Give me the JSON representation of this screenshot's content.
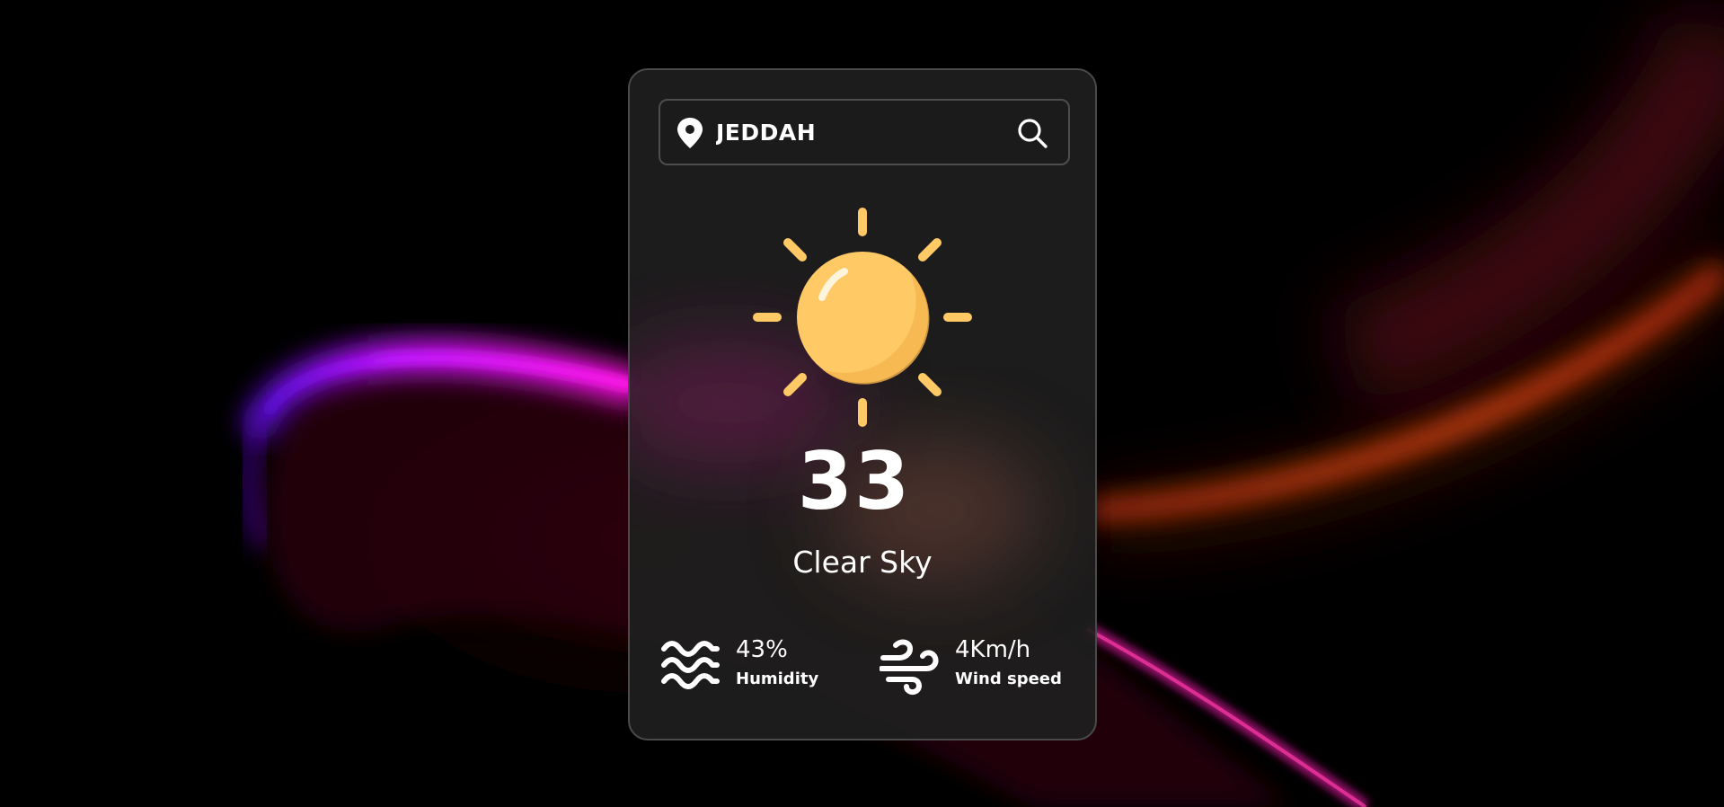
{
  "search": {
    "value": "JEDDAH"
  },
  "weather": {
    "temperature": "33",
    "description": "Clear Sky",
    "condition_icon": "sun-icon"
  },
  "details": {
    "humidity": {
      "value": "43%",
      "label": "Humidity",
      "icon": "humidity-waves-icon"
    },
    "wind": {
      "value": "4Km/h",
      "label": "Wind speed",
      "icon": "wind-icon"
    }
  },
  "colors": {
    "background": "#000000",
    "card": "#1e1e1e",
    "sun": "#ffc965",
    "accent_magenta": "#ff1ee6",
    "accent_orange": "#d9480f",
    "text": "#ffffff"
  }
}
